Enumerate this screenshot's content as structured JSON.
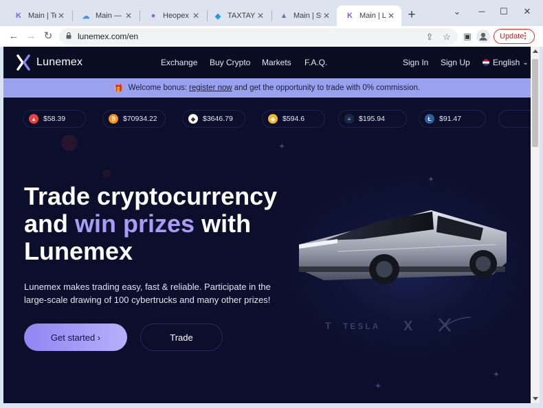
{
  "browser": {
    "tabs": [
      {
        "title": "Main | Telun",
        "fav": "K",
        "favColor": "#7b5cf0"
      },
      {
        "title": "Main — Yel",
        "fav": "☁",
        "favColor": "#4a8fe0"
      },
      {
        "title": "Heopex - H",
        "fav": "●",
        "favColor": "#8b5cf6"
      },
      {
        "title": "TAXTAY | De",
        "fav": "◆",
        "favColor": "#1e9be8"
      },
      {
        "title": "Main | Start",
        "fav": "▲",
        "favColor": "#6b7a99"
      },
      {
        "title": "Main | Lune",
        "fav": "K",
        "favColor": "#7b5cf0"
      }
    ],
    "url": "lunemex.com/en",
    "update_label": "Update"
  },
  "site": {
    "brand": "Lunemex",
    "nav": [
      "Exchange",
      "Buy Crypto",
      "Markets",
      "F.A.Q."
    ],
    "sign_in": "Sign In",
    "sign_up": "Sign Up",
    "language": "English",
    "banner": {
      "prefix": "Welcome bonus:",
      "link": "register now",
      "suffix": "and get the opportunity to trade with 0% commission."
    },
    "tickers": [
      {
        "price": "$58.39",
        "icon": "avalanche-icon",
        "color": "#e84142"
      },
      {
        "price": "$70934.22",
        "icon": "bitcoin-icon",
        "color": "#f7931a"
      },
      {
        "price": "$3646.79",
        "icon": "ethereum-icon",
        "color": "#ffffff"
      },
      {
        "price": "$594.6",
        "icon": "bnb-icon",
        "color": "#f3ba2f"
      },
      {
        "price": "$195.94",
        "icon": "solana-icon",
        "color": "#1c2447"
      },
      {
        "price": "$91.47",
        "icon": "litecoin-icon",
        "color": "#345d9d"
      }
    ],
    "hero": {
      "line1": "Trade cryptocurrency",
      "line2_a": "and",
      "line2_hl": "win prizes",
      "line2_b": "with",
      "line3": "Lunemex",
      "subtitle": "Lunemex makes trading easy, fast & reliable. Participate in the large-scale drawing of 100 cybertrucks and many other prizes!",
      "primary_button": "Get started ›",
      "secondary_button": "Trade"
    },
    "partners": [
      "TESLA",
      "X"
    ],
    "accent": "#a99cf7"
  }
}
